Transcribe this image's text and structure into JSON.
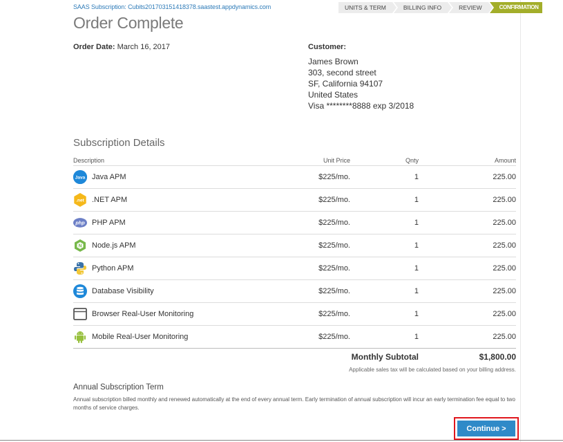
{
  "header": {
    "subscription_link": "SAAS Subscription: Cubits201703151418378.saastest.appdynamics.com",
    "steps": [
      {
        "label": "UNITS & TERM",
        "active": false
      },
      {
        "label": "BILLING INFO",
        "active": false
      },
      {
        "label": "REVIEW",
        "active": false
      },
      {
        "label": "CONFIRMATION",
        "active": true
      }
    ]
  },
  "title": "Order Complete",
  "order": {
    "date_label": "Order Date:",
    "date_value": "March 16, 2017"
  },
  "customer": {
    "label": "Customer:",
    "name": "James Brown",
    "street": "303, second street",
    "city": "SF, California 94107",
    "country": "United States",
    "payment": "Visa ********8888 exp 3/2018"
  },
  "subscription": {
    "title": "Subscription Details",
    "columns": [
      "Description",
      "Unit Price",
      "Qnty",
      "Amount"
    ],
    "rows": [
      {
        "icon": "java-icon",
        "name": "Java APM",
        "price": "$225/mo.",
        "qty": "1",
        "amount": "225.00"
      },
      {
        "icon": "dotnet-icon",
        "name": ".NET APM",
        "price": "$225/mo.",
        "qty": "1",
        "amount": "225.00"
      },
      {
        "icon": "php-icon",
        "name": "PHP APM",
        "price": "$225/mo.",
        "qty": "1",
        "amount": "225.00"
      },
      {
        "icon": "nodejs-icon",
        "name": "Node.js APM",
        "price": "$225/mo.",
        "qty": "1",
        "amount": "225.00"
      },
      {
        "icon": "python-icon",
        "name": "Python APM",
        "price": "$225/mo.",
        "qty": "1",
        "amount": "225.00"
      },
      {
        "icon": "database-icon",
        "name": "Database Visibility",
        "price": "$225/mo.",
        "qty": "1",
        "amount": "225.00"
      },
      {
        "icon": "browser-icon",
        "name": "Browser Real-User Monitoring",
        "price": "$225/mo.",
        "qty": "1",
        "amount": "225.00"
      },
      {
        "icon": "android-icon",
        "name": "Mobile Real-User Monitoring",
        "price": "$225/mo.",
        "qty": "1",
        "amount": "225.00"
      }
    ],
    "subtotal_label": "Monthly Subtotal",
    "subtotal_value": "$1,800.00",
    "tax_note": "Applicable sales tax will be calculated based on your billing address."
  },
  "term": {
    "title": "Annual Subscription Term",
    "text": "Annual subscription billed monthly and renewed automatically at the end of every annual term. Early termination of annual subscription will incur an early termination fee equal to two months of service charges."
  },
  "actions": {
    "continue_label": "Continue >"
  },
  "colors": {
    "accent": "#2f8ac8",
    "step_active": "#a3ae2a",
    "highlight_border": "#e0161d"
  }
}
